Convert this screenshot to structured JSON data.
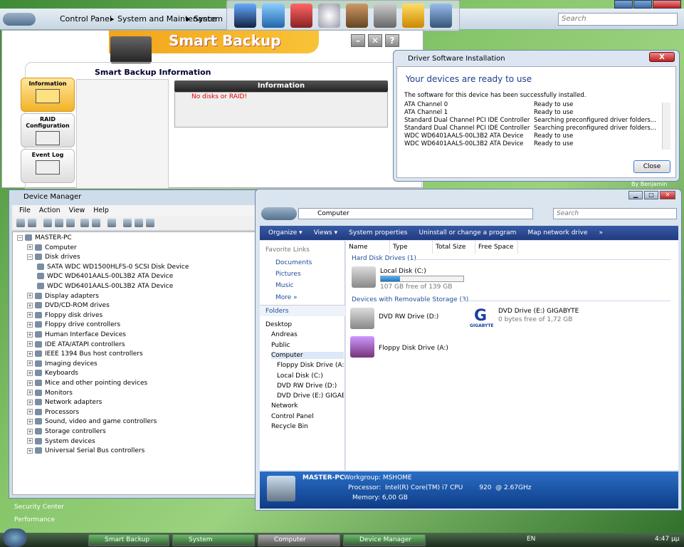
{
  "system_bar": {
    "breadcrumb": [
      "Control Panel",
      "System and Maintenance",
      "System"
    ],
    "search_placeholder": "Search"
  },
  "smart_backup": {
    "title": "Smart Backup",
    "info_title": "Smart Backup Information",
    "tabs": [
      {
        "label": "Information"
      },
      {
        "label": "RAID Configuration"
      },
      {
        "label": "Event Log"
      }
    ],
    "info_header": "Information",
    "message": "No disks or RAID!",
    "controls": [
      "–",
      "✕",
      "?"
    ]
  },
  "driver_dialog": {
    "title": "Driver Software Installation",
    "heading": "Your devices are ready to use",
    "message": "The software for this device has been successfully installed.",
    "rows": [
      {
        "name": "ATA Channel 0",
        "status": "Ready to use"
      },
      {
        "name": "ATA Channel 1",
        "status": "Ready to use"
      },
      {
        "name": "Standard Dual Channel PCI IDE Controller",
        "status": "Searching preconfigured driver folders..."
      },
      {
        "name": "Standard Dual Channel PCI IDE Controller",
        "status": "Searching preconfigured driver folders..."
      },
      {
        "name": "WDC WD6401AALS-00L3B2 ATA Device",
        "status": "Ready to use"
      },
      {
        "name": "WDC WD6401AALS-00L3B2 ATA Device",
        "status": "Ready to use"
      }
    ],
    "close_label": "Close",
    "close_x": "X"
  },
  "device_manager": {
    "title": "Device Manager",
    "menu": [
      "File",
      "Action",
      "View",
      "Help"
    ],
    "root": "MASTER-PC",
    "computer": "Computer",
    "disk_drives": "Disk drives",
    "disks": [
      "SATA WDC WD1500HLFS-0 SCSI Disk Device",
      "WDC WD6401AALS-00L3B2 ATA Device",
      "WDC WD6401AALS-00L3B2 ATA Device"
    ],
    "categories": [
      "Display adapters",
      "DVD/CD-ROM drives",
      "Floppy disk drives",
      "Floppy drive controllers",
      "Human Interface Devices",
      "IDE ATA/ATAPI controllers",
      "IEEE 1394 Bus host controllers",
      "Imaging devices",
      "Keyboards",
      "Mice and other pointing devices",
      "Monitors",
      "Network adapters",
      "Processors",
      "Sound, video and game controllers",
      "Storage controllers",
      "System devices",
      "Universal Serial Bus controllers"
    ]
  },
  "computer_window": {
    "address": "Computer",
    "search_placeholder": "Search",
    "commands": [
      "Organize ▾",
      "Views ▾",
      "System properties",
      "Uninstall or change a program",
      "Map network drive",
      "»"
    ],
    "favorite_links_title": "Favorite Links",
    "favorites": [
      "Documents",
      "Pictures",
      "Music",
      "More »"
    ],
    "folders_title": "Folders",
    "folders": [
      "Desktop",
      "Andreas",
      "Public",
      "Computer",
      "Floppy Disk Drive (A:)",
      "Local Disk (C:)",
      "DVD RW Drive (D:)",
      "DVD Drive (E:) GIGABY",
      "Network",
      "Control Panel",
      "Recycle Bin"
    ],
    "columns": [
      "Name",
      "Type",
      "Total Size",
      "Free Space"
    ],
    "hdd_group": "Hard Disk Drives (1)",
    "local_disk": {
      "label": "Local Disk (C:)",
      "free": "107 GB free of 139 GB",
      "used_fraction": 0.23
    },
    "removable_group": "Devices with Removable Storage (3)",
    "dvd_rw": "DVD RW Drive (D:)",
    "dvd_e": {
      "label": "DVD Drive (E:) GIGABYTE",
      "free": "0 bytes free of 1,72 GB",
      "logo": "GIGABYTE"
    },
    "floppy": "Floppy Disk Drive (A:)",
    "details": {
      "name": "MASTER-PC",
      "workgroup": "Workgroup:  MSHOME",
      "processor": "Processor:  Intel(R) Core(TM) i7 CPU        920  @ 2.67GHz",
      "memory": "Memory:  6,00 GB"
    }
  },
  "sidebar": {
    "items": [
      "Security Center",
      "Performance"
    ]
  },
  "taskbar": {
    "tasks": [
      "Smart Backup",
      "System",
      "Computer",
      "Device Manager"
    ],
    "lang": "EN",
    "clock": "4:47 μμ"
  },
  "watermark": "By Benjamin"
}
